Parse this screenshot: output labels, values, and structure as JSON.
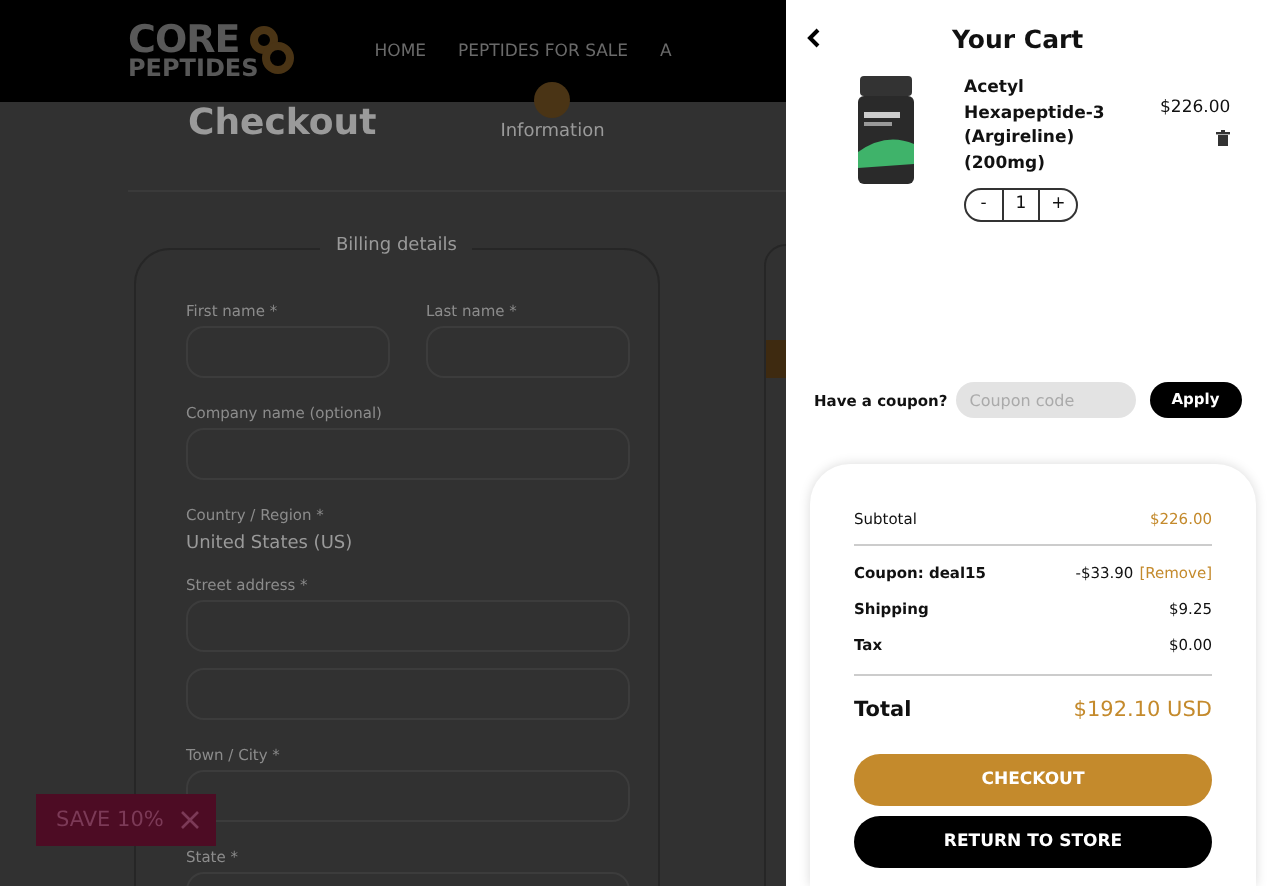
{
  "header": {
    "logo_top": "CORE",
    "logo_bottom": "PEPTIDES",
    "nav": [
      "HOME",
      "PEPTIDES FOR SALE",
      "A"
    ]
  },
  "checkout": {
    "title": "Checkout",
    "step_label": "Information"
  },
  "billing": {
    "legend": "Billing details",
    "fields": [
      {
        "kind": "half",
        "label": "First name *"
      },
      {
        "kind": "half",
        "label": "Last name *"
      },
      {
        "kind": "full",
        "label": "Company name (optional)"
      },
      {
        "kind": "value",
        "label": "Country / Region *",
        "value": "United States (US)"
      },
      {
        "kind": "full",
        "label": "Street address *"
      },
      {
        "kind": "blank"
      },
      {
        "kind": "full",
        "label": "Town / City *"
      },
      {
        "kind": "full",
        "label": "State *"
      }
    ]
  },
  "promo": {
    "text": "SAVE 10%"
  },
  "cart": {
    "title": "Your Cart",
    "item": {
      "name": "Acetyl Hexapeptide-3 (Argireline) (200mg)",
      "price": "$226.00",
      "minus": "-",
      "qty": "1",
      "plus": "+"
    },
    "coupon": {
      "label": "Have a coupon?",
      "placeholder": "Coupon code",
      "button": "Apply"
    },
    "summary": [
      {
        "kind": "subtotal",
        "label": "Subtotal",
        "value": "$226.00"
      },
      {
        "kind": "coupon",
        "label": "Coupon: deal15",
        "value": "-$33.90",
        "link": "[Remove]"
      },
      {
        "kind": "line",
        "label": "Shipping",
        "value": "$9.25"
      },
      {
        "kind": "line",
        "label": "Tax",
        "value": "$0.00"
      },
      {
        "kind": "total",
        "label": "Total",
        "value": "$192.10 USD"
      }
    ],
    "checkout_button": "CHECKOUT",
    "return_button": "RETURN TO STORE"
  }
}
